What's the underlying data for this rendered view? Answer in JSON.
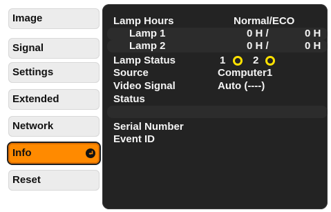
{
  "menu": {
    "items": [
      {
        "label": "Image"
      },
      {
        "label": "Signal"
      },
      {
        "label": "Settings"
      },
      {
        "label": "Extended"
      },
      {
        "label": "Network"
      },
      {
        "label": "Info",
        "active": true
      },
      {
        "label": "Reset"
      }
    ]
  },
  "info": {
    "lamp_hours_label": "Lamp Hours",
    "lamp_hours_mode": "Normal/ECO",
    "lamp1_label": "Lamp 1",
    "lamp1_normal": "0 H /",
    "lamp1_eco": "0 H",
    "lamp2_label": "Lamp 2",
    "lamp2_normal": "0 H /",
    "lamp2_eco": "0 H",
    "lamp_status_label": "Lamp Status",
    "lamp_status_1": "1",
    "lamp_status_2": "2",
    "source_label": "Source",
    "source_value": "Computer1",
    "video_signal_label": "Video Signal",
    "video_signal_value": "Auto (----)",
    "status_label": "Status",
    "serial_number_label": "Serial Number",
    "event_id_label": "Event ID"
  },
  "colors": {
    "active_tab": "#ff8a00",
    "panel_bg": "#232323",
    "lamp_indicator": "#ffe100"
  },
  "icons": {
    "enter": "enter-return-icon"
  }
}
